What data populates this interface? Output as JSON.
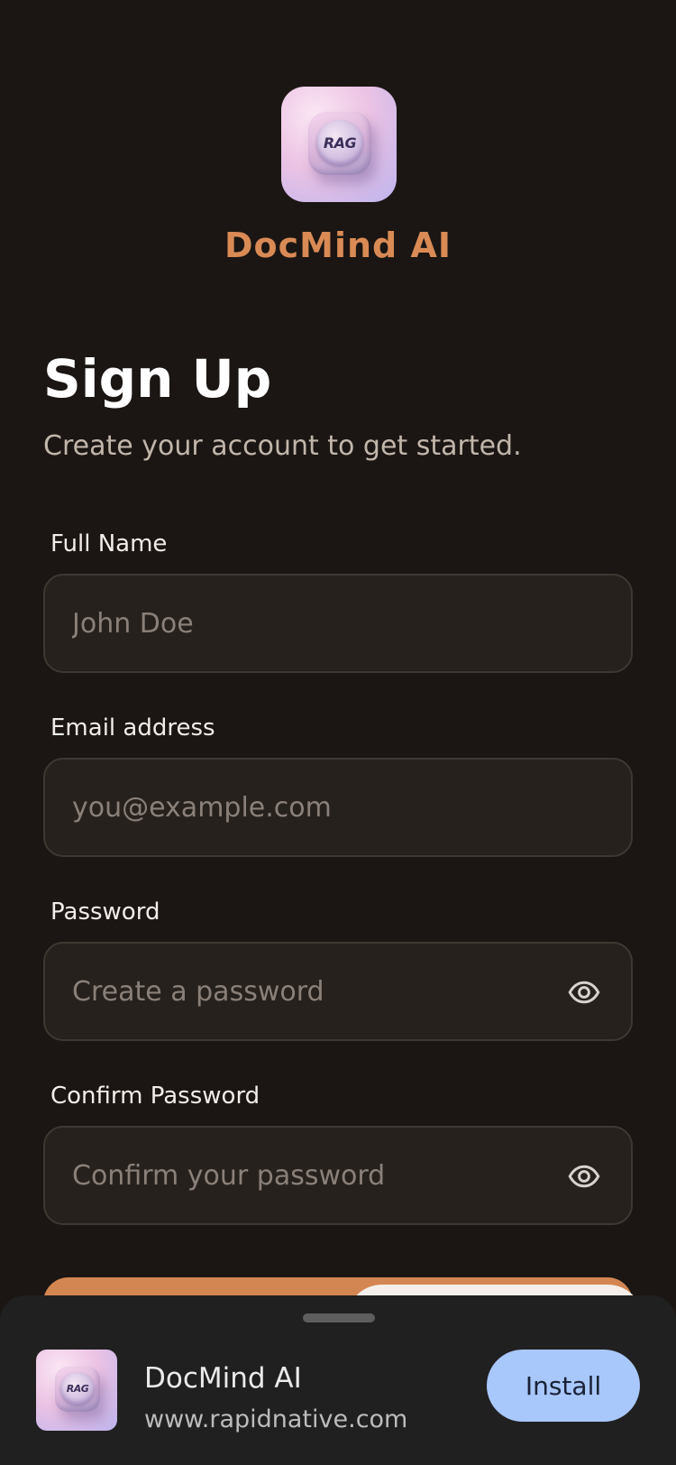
{
  "app": {
    "name": "DocMind AI",
    "logo_text": "RAG"
  },
  "header": {
    "title": "Sign Up",
    "subtitle": "Create your account to get started."
  },
  "form": {
    "full_name": {
      "label": "Full Name",
      "placeholder": "John Doe"
    },
    "email": {
      "label": "Email address",
      "placeholder": "you@example.com"
    },
    "password": {
      "label": "Password",
      "placeholder": "Create a password"
    },
    "confirm_password": {
      "label": "Confirm Password",
      "placeholder": "Confirm your password"
    }
  },
  "install_sheet": {
    "title": "DocMind AI",
    "url": "www.rapidnative.com",
    "install_label": "Install",
    "logo_text": "RAG"
  },
  "colors": {
    "background": "#1b1613",
    "brand": "#d98a55",
    "primary_button": "#d48652",
    "install_button": "#a8c7fa"
  }
}
